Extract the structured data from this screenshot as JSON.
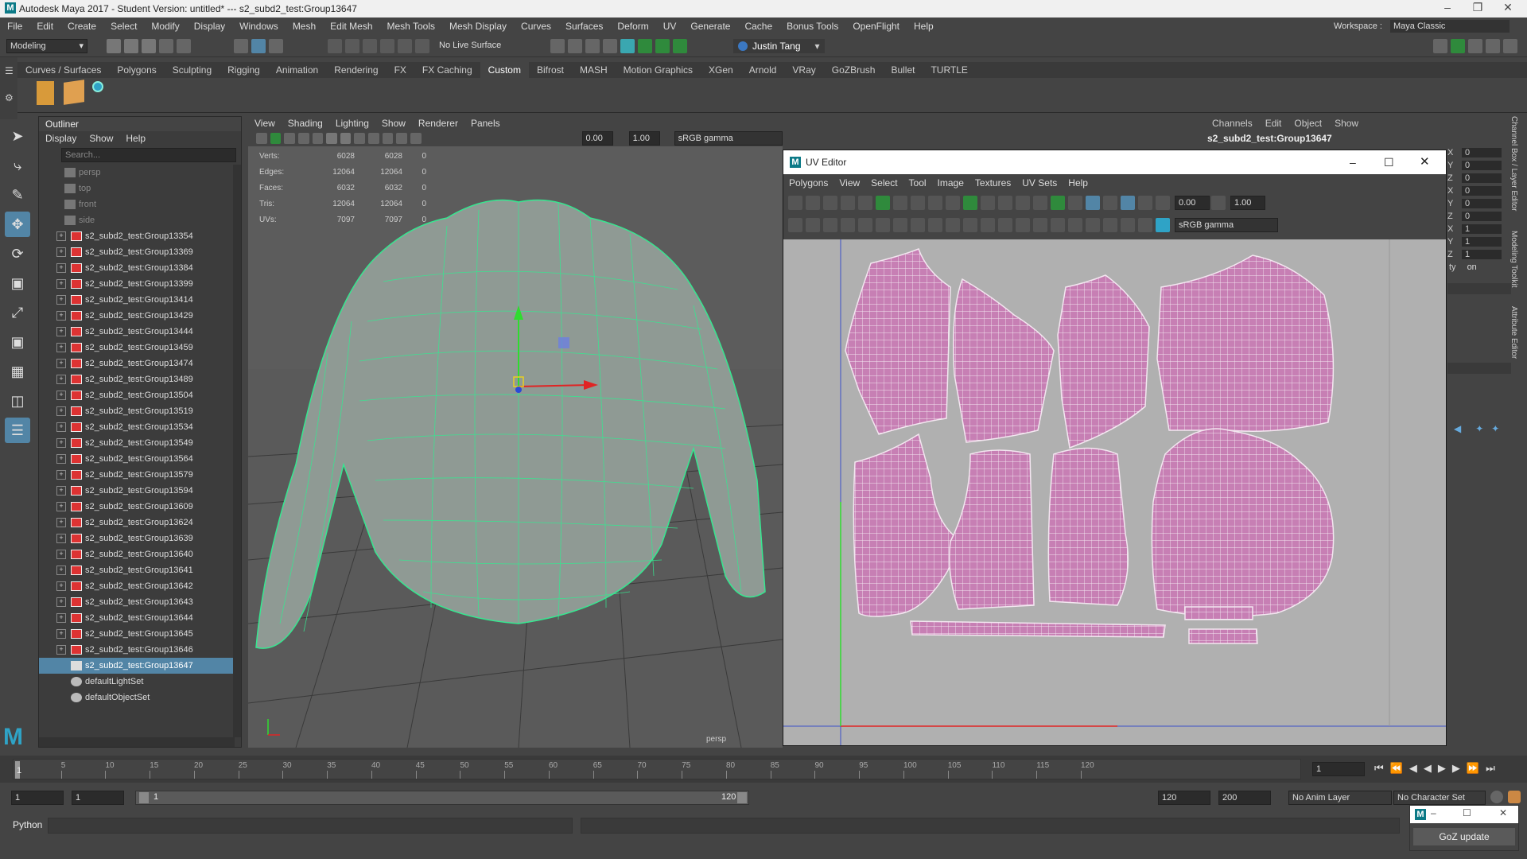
{
  "window": {
    "title": "Autodesk Maya 2017 - Student Version: untitled*   ---   s2_subd2_test:Group13647"
  },
  "menus": [
    "File",
    "Edit",
    "Create",
    "Select",
    "Modify",
    "Display",
    "Windows",
    "Mesh",
    "Edit Mesh",
    "Mesh Tools",
    "Mesh Display",
    "Curves",
    "Surfaces",
    "Deform",
    "UV",
    "Generate",
    "Cache",
    "Bonus Tools",
    "OpenFlight",
    "Help"
  ],
  "workspace": {
    "label": "Workspace :",
    "value": "Maya Classic"
  },
  "toolbar": {
    "mode": "Modeling",
    "live_surface": "No Live Surface",
    "user": "Justin Tang"
  },
  "shelf_tabs": [
    "Curves / Surfaces",
    "Polygons",
    "Sculpting",
    "Rigging",
    "Animation",
    "Rendering",
    "FX",
    "FX Caching",
    "Custom",
    "Bifrost",
    "MASH",
    "Motion Graphics",
    "XGen",
    "Arnold",
    "VRay",
    "GoZBrush",
    "Bullet",
    "TURTLE"
  ],
  "shelf_active": "Custom",
  "outliner": {
    "title": "Outliner",
    "menu": [
      "Display",
      "Show",
      "Help"
    ],
    "search_placeholder": "Search...",
    "cameras": [
      "persp",
      "top",
      "front",
      "side"
    ],
    "groups": [
      "s2_subd2_test:Group13354",
      "s2_subd2_test:Group13369",
      "s2_subd2_test:Group13384",
      "s2_subd2_test:Group13399",
      "s2_subd2_test:Group13414",
      "s2_subd2_test:Group13429",
      "s2_subd2_test:Group13444",
      "s2_subd2_test:Group13459",
      "s2_subd2_test:Group13474",
      "s2_subd2_test:Group13489",
      "s2_subd2_test:Group13504",
      "s2_subd2_test:Group13519",
      "s2_subd2_test:Group13534",
      "s2_subd2_test:Group13549",
      "s2_subd2_test:Group13564",
      "s2_subd2_test:Group13579",
      "s2_subd2_test:Group13594",
      "s2_subd2_test:Group13609",
      "s2_subd2_test:Group13624",
      "s2_subd2_test:Group13639",
      "s2_subd2_test:Group13640",
      "s2_subd2_test:Group13641",
      "s2_subd2_test:Group13642",
      "s2_subd2_test:Group13643",
      "s2_subd2_test:Group13644",
      "s2_subd2_test:Group13645",
      "s2_subd2_test:Group13646"
    ],
    "selected": "s2_subd2_test:Group13647",
    "sets": [
      "defaultLightSet",
      "defaultObjectSet"
    ]
  },
  "viewport": {
    "menu": [
      "View",
      "Shading",
      "Lighting",
      "Show",
      "Renderer",
      "Panels"
    ],
    "field_a": "0.00",
    "field_b": "1.00",
    "colorspace": "sRGB gamma",
    "camera_label": "persp",
    "stats": [
      {
        "label": "Verts:",
        "a": "6028",
        "b": "6028",
        "c": "0"
      },
      {
        "label": "Edges:",
        "a": "12064",
        "b": "12064",
        "c": "0"
      },
      {
        "label": "Faces:",
        "a": "6032",
        "b": "6032",
        "c": "0"
      },
      {
        "label": "Tris:",
        "a": "12064",
        "b": "12064",
        "c": "0"
      },
      {
        "label": "UVs:",
        "a": "7097",
        "b": "7097",
        "c": "0"
      }
    ]
  },
  "channel_box": {
    "menu": [
      "Channels",
      "Edit",
      "Object",
      "Show"
    ],
    "object": "s2_subd2_test:Group13647",
    "axes": [
      "X",
      "Y",
      "Z",
      "X",
      "Y",
      "Z",
      "X",
      "Y",
      "Z"
    ],
    "values": [
      "0",
      "0",
      "0",
      "0",
      "0",
      "0",
      "1",
      "1",
      "1"
    ],
    "visibility_label": "ty",
    "visibility_value": "on",
    "side_tabs": [
      "Channel Box / Layer Editor",
      "Modeling Toolkit",
      "Attribute Editor"
    ]
  },
  "uv_editor": {
    "title": "UV Editor",
    "menu": [
      "Polygons",
      "View",
      "Select",
      "Tool",
      "Image",
      "Textures",
      "UV Sets",
      "Help"
    ],
    "field_a": "0.00",
    "field_b": "1.00",
    "colorspace": "sRGB gamma",
    "shell_color": "#c77fb4"
  },
  "timeline": {
    "ticks": [
      "5",
      "10",
      "15",
      "20",
      "25",
      "30",
      "35",
      "40",
      "45",
      "50",
      "55",
      "60",
      "65",
      "70",
      "75",
      "80",
      "85",
      "90",
      "95",
      "100",
      "105",
      "110",
      "115",
      "120"
    ],
    "current_frame": "1",
    "frame_field": "1"
  },
  "range": {
    "start": "1",
    "playback_start": "1",
    "slider_start": "1",
    "slider_end": "120",
    "playback_end": "120",
    "end": "200",
    "anim_layer": "No Anim Layer",
    "character_set": "No Character Set"
  },
  "cmdline": {
    "label": "Python"
  },
  "goz": {
    "label": "GoZ update"
  },
  "colors": {
    "wire": "#35e890",
    "selection": "#5285a6",
    "mesh": "#8f9a94"
  }
}
